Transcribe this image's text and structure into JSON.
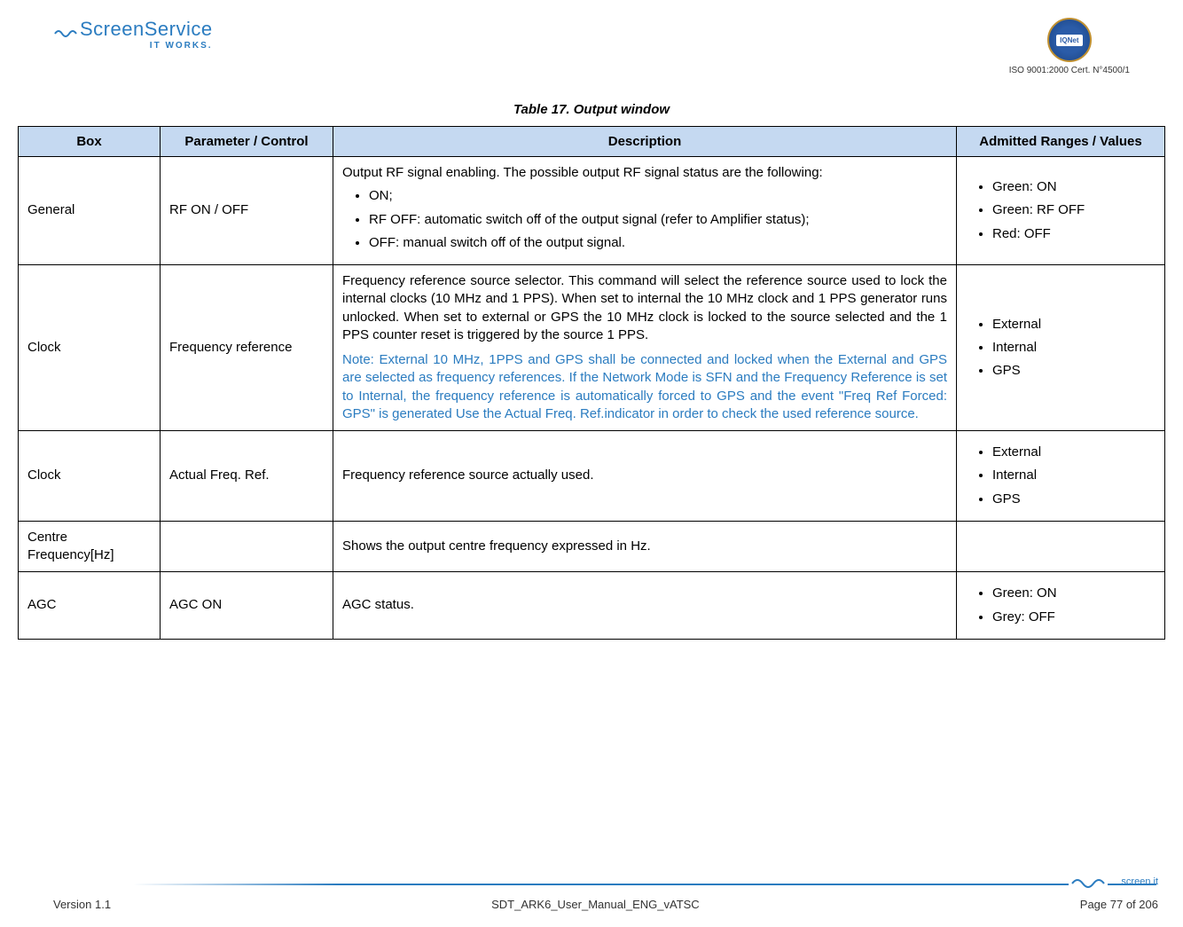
{
  "header": {
    "logo_main": "ScreenService",
    "logo_sub": "IT WORKS.",
    "iqnet_label": "IQNet",
    "iso_text": "ISO 9001:2000 Cert. N°4500/1"
  },
  "table_title": "Table 17.      Output window",
  "columns": {
    "box": "Box",
    "param": "Parameter / Control",
    "desc": "Description",
    "range": "Admitted Ranges / Values"
  },
  "rows": {
    "r0": {
      "box": "General",
      "param": "RF ON / OFF",
      "desc_intro": "Output RF signal enabling. The possible output RF signal status are the following:",
      "desc_items": {
        "0": "ON;",
        "1": "RF OFF: automatic switch off of the output signal (refer to Amplifier status);",
        "2": "OFF: manual switch off of the output signal."
      },
      "range_items": {
        "0": "Green: ON",
        "1": "Green: RF OFF",
        "2": "Red: OFF"
      }
    },
    "r1": {
      "box": "Clock",
      "param": "Frequency reference",
      "desc_para": "Frequency reference source selector. This command will select the reference source used to lock the internal clocks (10 MHz and 1 PPS). When set to internal the 10 MHz clock and 1 PPS generator runs unlocked. When set to external or GPS the 10 MHz clock is locked to the source selected and the 1 PPS counter reset is triggered by the source 1 PPS.",
      "desc_note": "Note: External 10 MHz, 1PPS and GPS shall be connected and locked when the External and GPS are selected as frequency references. If the Network Mode is SFN and the Frequency Reference is set to Internal, the frequency reference is automatically forced to GPS and the event \"Freq Ref Forced: GPS\" is generated Use the Actual Freq. Ref.indicator in order to check the used reference source.",
      "range_items": {
        "0": "External",
        "1": "Internal",
        "2": "GPS"
      }
    },
    "r2": {
      "box": "Clock",
      "param": "Actual Freq. Ref.",
      "desc": "Frequency reference source actually used.",
      "range_items": {
        "0": "External",
        "1": "Internal",
        "2": "GPS"
      }
    },
    "r3": {
      "box": "Centre Frequency[Hz]",
      "param": "",
      "desc": "Shows the output centre frequency expressed in Hz.",
      "range": ""
    },
    "r4": {
      "box": "AGC",
      "param": "AGC ON",
      "desc": "AGC status.",
      "range_items": {
        "0": "Green: ON",
        "1": "Grey: OFF"
      }
    }
  },
  "footer": {
    "screenit": "screen.it",
    "version": "Version 1.1",
    "doc": "SDT_ARK6_User_Manual_ENG_vATSC",
    "page": "Page 77 of 206"
  }
}
